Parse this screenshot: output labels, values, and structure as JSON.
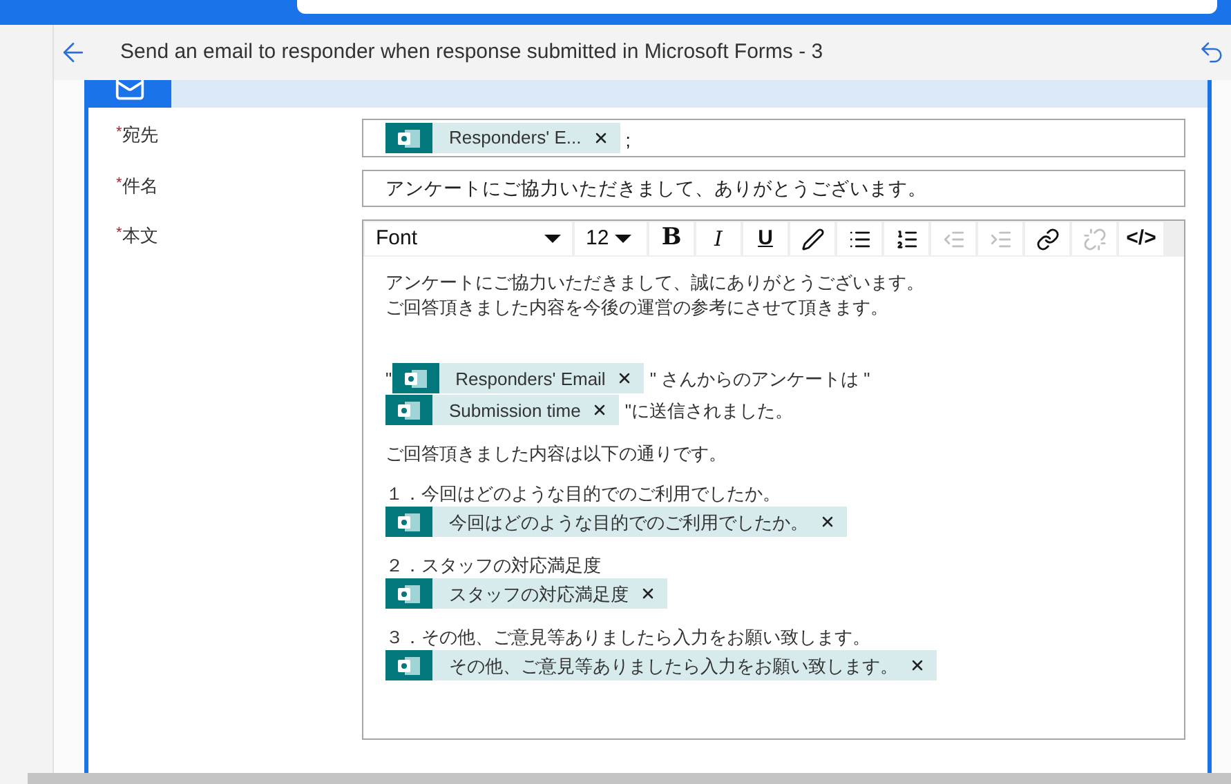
{
  "title_bar": {
    "title": "Send an email to responder when response submitted in Microsoft Forms - 3"
  },
  "fields": [
    {
      "label": "宛先",
      "marker": "*",
      "kind": "tokens",
      "tokens": [
        "Responders' E..."
      ],
      "suffix": ";"
    },
    {
      "label": "件名",
      "marker": "*",
      "kind": "text",
      "value": "アンケートにご協力いただきまして、ありがとうございます。"
    },
    {
      "label": "本文",
      "marker": "*",
      "kind": "editor"
    }
  ],
  "editor": {
    "font": "Font",
    "size": "12",
    "tools": [
      {
        "kind": "bold",
        "label": "B",
        "disabled": false
      },
      {
        "kind": "italic",
        "label": "I",
        "disabled": false
      },
      {
        "kind": "underline",
        "label": "U",
        "disabled": false
      },
      {
        "kind": "pen",
        "disabled": false
      },
      {
        "kind": "bullets",
        "disabled": false
      },
      {
        "kind": "numbers",
        "disabled": false
      },
      {
        "kind": "outdent",
        "disabled": true
      },
      {
        "kind": "indent",
        "disabled": true
      },
      {
        "kind": "link",
        "disabled": false
      },
      {
        "kind": "unlink",
        "disabled": true
      },
      {
        "kind": "code",
        "label": "</>",
        "disabled": false
      }
    ],
    "paragraphs": [
      [
        [
          {
            "kind": "text",
            "text": "アンケートにご協力いただきまして、誠にありがとうございます。"
          }
        ],
        [
          {
            "kind": "text",
            "text": "ご回答頂きました内容を今後の運営の参考にさせて頂きます。"
          }
        ]
      ],
      [
        [
          {
            "kind": "text",
            "text": "\""
          },
          {
            "kind": "token",
            "text": "Responders' Email"
          },
          {
            "kind": "text",
            "text": "\" さんからのアンケートは \""
          }
        ],
        [
          {
            "kind": "token",
            "text": "Submission time"
          },
          {
            "kind": "text",
            "text": "\"に送信されました。"
          }
        ]
      ],
      [
        [
          {
            "kind": "text",
            "text": "ご回答頂きました内容は以下の通りです。"
          }
        ]
      ],
      [
        [
          {
            "kind": "text",
            "text": "１．今回はどのような目的でのご利用でしたか。"
          }
        ],
        [
          {
            "kind": "token",
            "text": "今回はどのような目的でのご利用でしたか。"
          }
        ]
      ],
      [
        [
          {
            "kind": "text",
            "text": "２．スタッフの対応満足度"
          }
        ],
        [
          {
            "kind": "token",
            "text": "スタッフの対応満足度"
          }
        ]
      ],
      [
        [
          {
            "kind": "text",
            "text": "３．その他、ご意見等ありましたら入力をお願い致します。"
          }
        ],
        [
          {
            "kind": "token",
            "text": "その他、ご意見等ありましたら入力をお願い致します。"
          }
        ]
      ]
    ]
  }
}
